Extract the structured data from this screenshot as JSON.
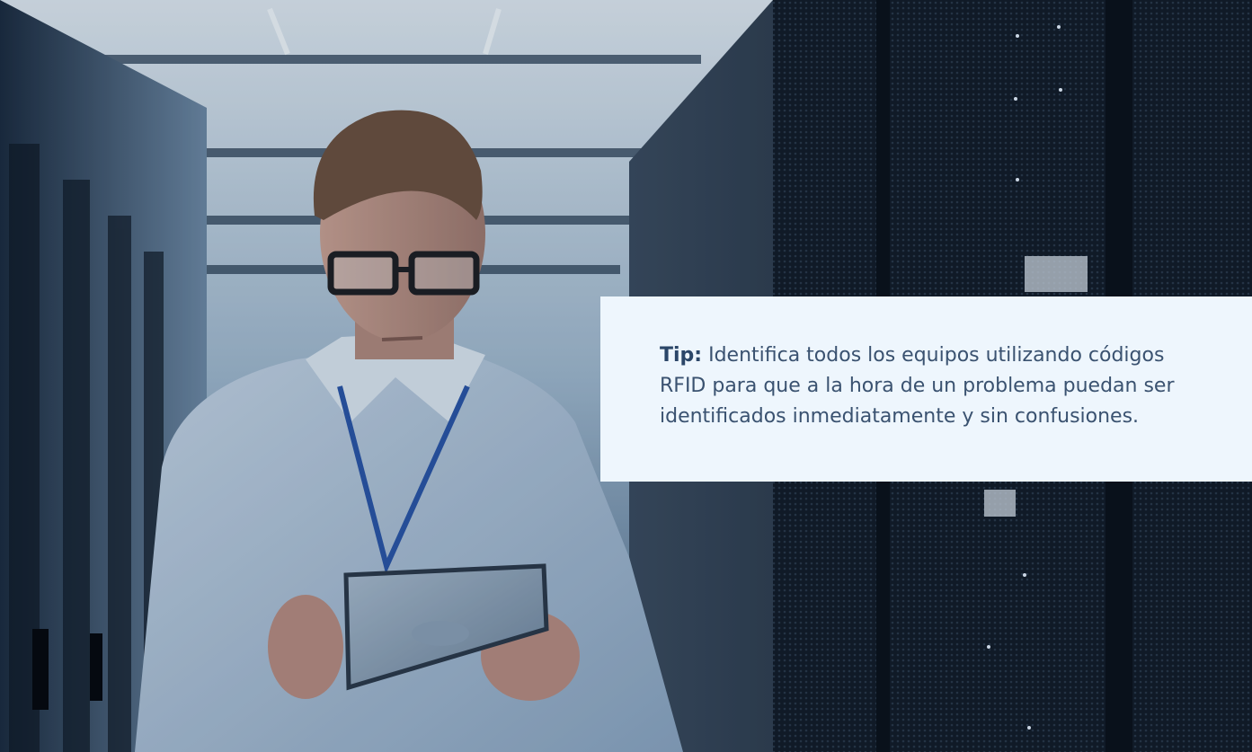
{
  "tip_card": {
    "label": "Tip:",
    "lines": [
      " Identifica todos los equipos utilizando códigos",
      "RFID para que a la hora de un problema puedan ser",
      "identificados inmediatamente y sin confusiones."
    ]
  },
  "colors": {
    "card_background": "#eef6fd",
    "text": "#3a5270",
    "label": "#2b4668"
  }
}
